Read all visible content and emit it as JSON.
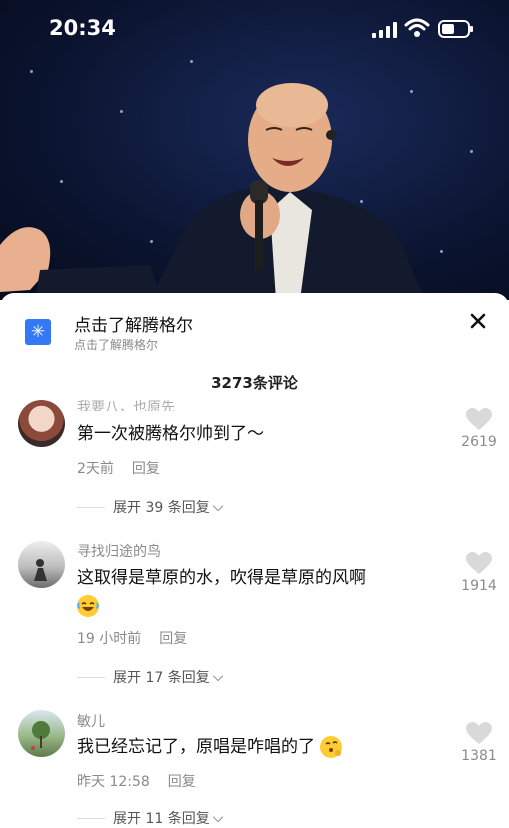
{
  "status_bar": {
    "time": "20:34"
  },
  "source_bar": {
    "title": "点击了解腾格尔",
    "subtitle": "点击了解腾格尔",
    "icon": "asterisk-icon"
  },
  "comments_header": {
    "count_label": "3273条评论"
  },
  "comments": [
    {
      "username": "我要八，也原先",
      "text": "第一次被腾格尔帅到了～",
      "emoji": "",
      "time": "2天前",
      "reply_label": "回复",
      "expand_label": "展开 39 条回复",
      "likes": "2619"
    },
    {
      "username": "寻找归途的鸟",
      "text": "这取得是草原的水，吹得是草原的风啊",
      "emoji": "laughing-tears-emoji",
      "time": "19 小时前",
      "reply_label": "回复",
      "expand_label": "展开 17 条回复",
      "likes": "1914"
    },
    {
      "username": "敏儿",
      "text": "我已经忘记了，原唱是咋唱的了",
      "emoji": "thinking-emoji",
      "time": "昨天 12:58",
      "reply_label": "回复",
      "expand_label": "展开 11 条回复",
      "likes": "1381"
    }
  ]
}
